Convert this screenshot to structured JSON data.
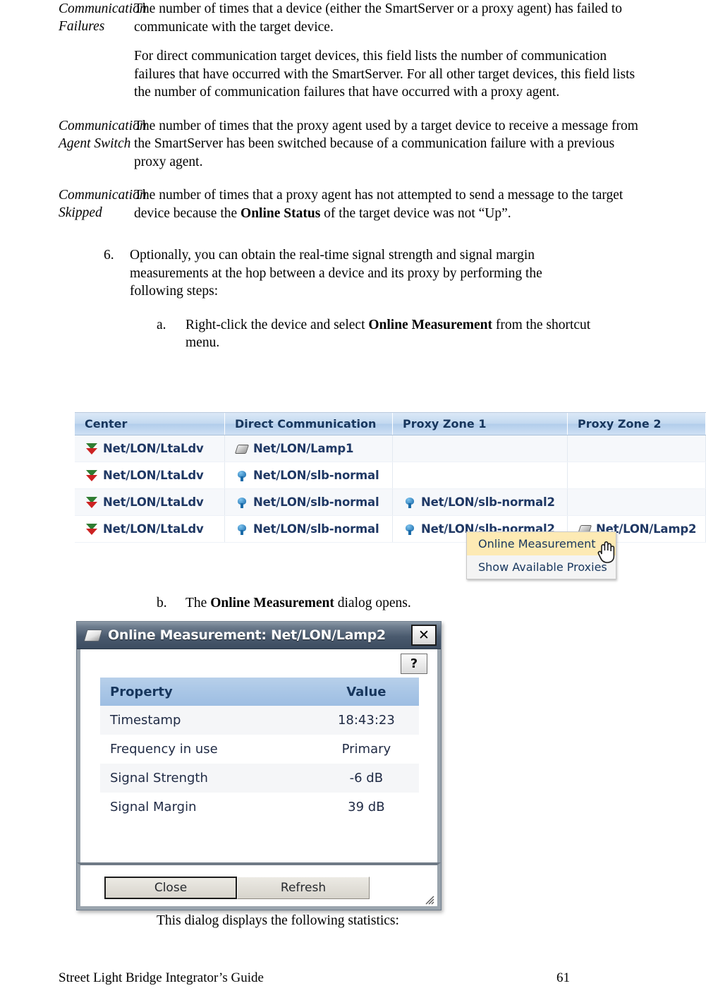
{
  "definitions": [
    {
      "term": "Communication Failures",
      "paragraphs": [
        "The number of times that a device (either the SmartServer or a proxy agent) has failed to communicate with the target device.",
        "For direct communication target devices, this field lists the number of communication failures that have occurred with the SmartServer.  For all other target devices, this field lists the number of communication failures that have occurred with a proxy agent."
      ]
    },
    {
      "term": "Communication Agent Switch",
      "paragraphs": [
        "The number of times that the proxy agent used by a target device to receive a message from the SmartServer has been switched because of a communication failure with a previous proxy agent."
      ]
    },
    {
      "term": "Communication Skipped",
      "paragraphs": [
        "The number of times that a proxy agent has not attempted to send a message to the target device because the Online Status of the target device was not “Up”."
      ]
    }
  ],
  "step": {
    "number": "6.",
    "text": "Optionally, you can obtain the real-time signal strength and signal margin measurements at the hop between a device and its proxy by performing the following steps:"
  },
  "substeps": [
    {
      "number": "a.",
      "pre": "Right-click the device and select ",
      "bold": "Online Measurement",
      "post": " from the shortcut menu."
    },
    {
      "number": "b.",
      "pre": "The ",
      "bold": "Online Measurement",
      "post": " dialog opens."
    }
  ],
  "grid": {
    "headers": [
      "Center",
      "Direct Communication",
      "Proxy Zone 1",
      "Proxy Zone 2"
    ],
    "rows": [
      [
        {
          "icon": "ltaldv-device-icon",
          "label": "Net/LON/LtaLdv"
        },
        {
          "icon": "lamp-device-icon",
          "label": "Net/LON/Lamp1"
        },
        {
          "icon": "",
          "label": ""
        },
        {
          "icon": "",
          "label": ""
        }
      ],
      [
        {
          "icon": "ltaldv-device-icon",
          "label": "Net/LON/LtaLdv"
        },
        {
          "icon": "slb-device-icon",
          "label": "Net/LON/slb-normal"
        },
        {
          "icon": "",
          "label": ""
        },
        {
          "icon": "",
          "label": ""
        }
      ],
      [
        {
          "icon": "ltaldv-device-icon",
          "label": "Net/LON/LtaLdv"
        },
        {
          "icon": "slb-device-icon",
          "label": "Net/LON/slb-normal"
        },
        {
          "icon": "slb-device-icon",
          "label": "Net/LON/slb-normal2"
        },
        {
          "icon": "",
          "label": ""
        }
      ],
      [
        {
          "icon": "ltaldv-device-icon",
          "label": "Net/LON/LtaLdv"
        },
        {
          "icon": "slb-device-icon",
          "label": "Net/LON/slb-normal"
        },
        {
          "icon": "slb-device-icon",
          "label": "Net/LON/slb-normal2"
        },
        {
          "icon": "lamp-device-icon",
          "label": "Net/LON/Lamp2"
        }
      ]
    ]
  },
  "context_menu": {
    "items": [
      {
        "label": "Online Measurement",
        "highlighted": true
      },
      {
        "label": "Show Available Proxies",
        "highlighted": false
      }
    ],
    "highlight_color": "#fdeab4"
  },
  "dialog": {
    "title": "Online Measurement: Net/LON/Lamp2",
    "close_label": "✕",
    "help_label": "?",
    "table": {
      "headers": [
        "Property",
        "Value"
      ],
      "rows": [
        [
          "Timestamp",
          "18:43:23"
        ],
        [
          "Frequency in use",
          "Primary"
        ],
        [
          "Signal Strength",
          "-6 dB"
        ],
        [
          "Signal Margin",
          "39 dB"
        ]
      ]
    },
    "buttons": [
      {
        "label": "Close",
        "default": true
      },
      {
        "label": "Refresh",
        "default": false
      }
    ]
  },
  "caption": "This dialog displays the following statistics:",
  "footer": {
    "title": "Street Light Bridge Integrator’s Guide",
    "page": "61"
  },
  "colors": {
    "grid_header": "#c3d9f0",
    "grid_header_text": "#17365d",
    "dialog_title_bar": "#4a5a6e",
    "dialog_table_header": "#a9c6e6",
    "menu_highlight": "#fdeab4"
  }
}
